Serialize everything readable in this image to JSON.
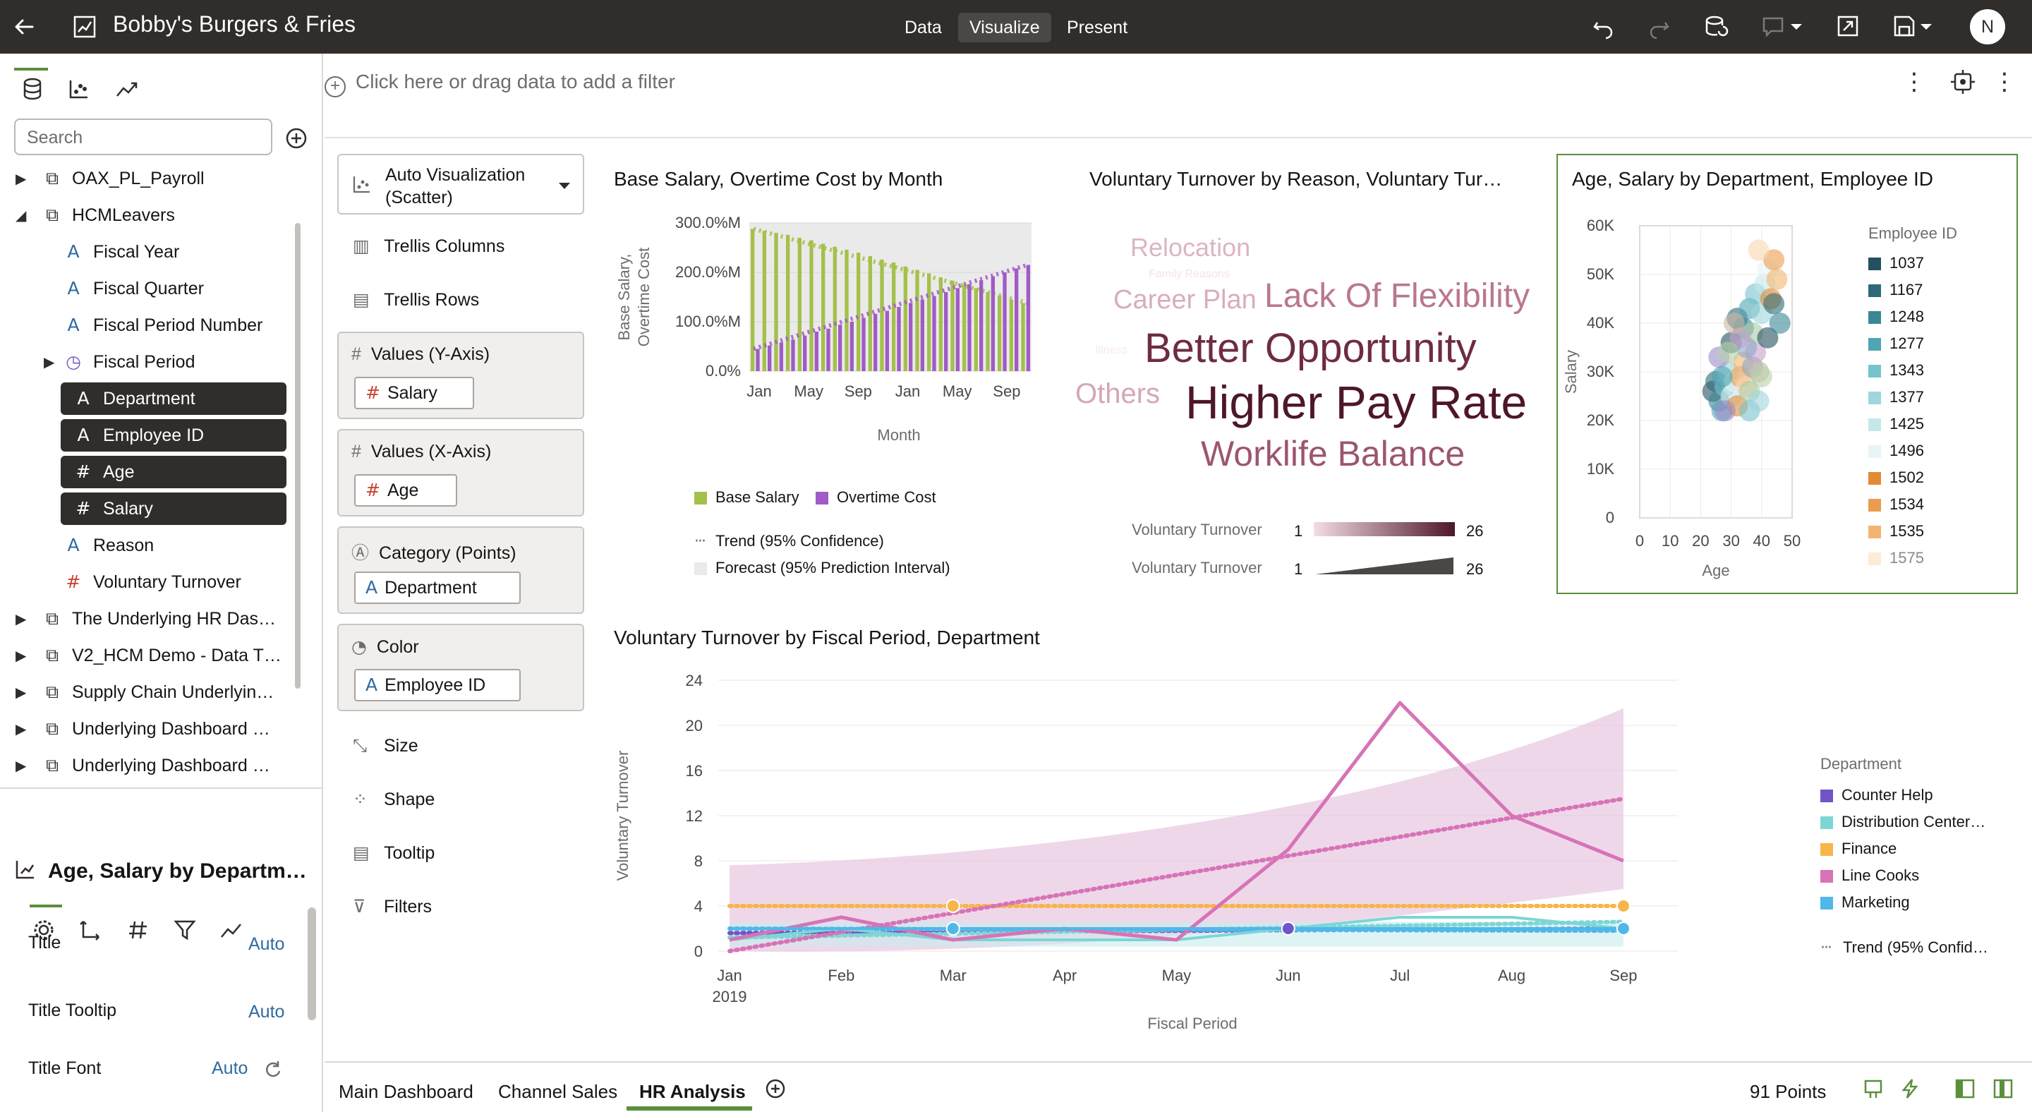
{
  "app": {
    "title": "Bobby's Burgers & Fries"
  },
  "modes": [
    "Data",
    "Visualize",
    "Present"
  ],
  "avatar": "N",
  "search": {
    "placeholder": "Search"
  },
  "tree": [
    {
      "label": "OAX_PL_Payroll",
      "level": 0,
      "icon": "dataset",
      "caret": "right"
    },
    {
      "label": "HCMLeavers",
      "level": 0,
      "icon": "dataset",
      "caret": "down"
    },
    {
      "label": "Fiscal Year",
      "level": 1,
      "icon": "A"
    },
    {
      "label": "Fiscal Quarter",
      "level": 1,
      "icon": "A"
    },
    {
      "label": "Fiscal Period Number",
      "level": 1,
      "icon": "A"
    },
    {
      "label": "Fiscal Period",
      "level": 1,
      "icon": "clock",
      "caret": "right"
    },
    {
      "label": "Department",
      "level": 1,
      "icon": "A",
      "selected": true
    },
    {
      "label": "Employee ID",
      "level": 1,
      "icon": "A",
      "selected": true
    },
    {
      "label": "Age",
      "level": 1,
      "icon": "#",
      "selected": true
    },
    {
      "label": "Salary",
      "level": 1,
      "icon": "#",
      "selected": true
    },
    {
      "label": "Reason",
      "level": 1,
      "icon": "A"
    },
    {
      "label": "Voluntary Turnover",
      "level": 1,
      "icon": "#"
    },
    {
      "label": "The Underlying HR Das…",
      "level": 0,
      "icon": "dataset",
      "caret": "right"
    },
    {
      "label": "V2_HCM Demo - Data T…",
      "level": 0,
      "icon": "dataset",
      "caret": "right"
    },
    {
      "label": "Supply Chain Underlyin…",
      "level": 0,
      "icon": "dataset",
      "caret": "right"
    },
    {
      "label": "Underlying Dashboard …",
      "level": 0,
      "icon": "dataset",
      "caret": "right"
    },
    {
      "label": "Underlying Dashboard …",
      "level": 0,
      "icon": "dataset",
      "caret": "right"
    }
  ],
  "properties": {
    "viz_title": "Age, Salary by Departm…",
    "rows": [
      {
        "label": "Title",
        "value": "Auto"
      },
      {
        "label": "Title Tooltip",
        "value": "Auto"
      },
      {
        "label": "Title Font",
        "value": "Auto"
      }
    ]
  },
  "filter_bar": {
    "prompt": "Click here or drag data to add a filter"
  },
  "grammar": {
    "viz_type": "Auto Visualization (Scatter)",
    "trellis_columns": "Trellis Columns",
    "trellis_rows": "Trellis Rows",
    "values_y": {
      "label": "Values (Y-Axis)",
      "item": "Salary"
    },
    "values_x": {
      "label": "Values (X-Axis)",
      "item": "Age"
    },
    "category": {
      "label": "Category (Points)",
      "item": "Department"
    },
    "color": {
      "label": "Color",
      "item": "Employee ID"
    },
    "size": "Size",
    "shape": "Shape",
    "tooltip": "Tooltip",
    "filters": "Filters"
  },
  "viz1": {
    "title": "Base Salary, Overtime Cost by Month",
    "legend": [
      "Base Salary",
      "Overtime Cost"
    ],
    "trend_label": "Trend (95% Confidence)",
    "forecast_label": "Forecast (95% Prediction Interval)"
  },
  "viz2": {
    "title": "Voluntary Turnover by Reason, Voluntary Tur…",
    "words": [
      {
        "text": "Relocation",
        "color": "#dcb5c0"
      },
      {
        "text": "Family Reasons",
        "color": "#f3e3e8"
      },
      {
        "text": "Career Plan",
        "color": "#d8adb9"
      },
      {
        "text": "Lack Of Flexibility",
        "color": "#b9788b"
      },
      {
        "text": "Illness",
        "color": "#f6e9ee"
      },
      {
        "text": "Better Opportunity",
        "color": "#6e2c41"
      },
      {
        "text": "Others",
        "color": "#d4a7b4"
      },
      {
        "text": "Higher Pay Rate",
        "color": "#4e1729"
      },
      {
        "text": "Worklife Balance",
        "color": "#9c5570"
      }
    ],
    "legend_label": "Voluntary Turnover",
    "legend_min": "1",
    "legend_max": "26"
  },
  "viz3": {
    "title": "Age, Salary by Department, Employee ID",
    "legend_title": "Employee ID",
    "legend": [
      {
        "id": "1037",
        "color": "#24505f"
      },
      {
        "id": "1167",
        "color": "#2c6a78"
      },
      {
        "id": "1248",
        "color": "#3a8796"
      },
      {
        "id": "1277",
        "color": "#4ea5b3"
      },
      {
        "id": "1343",
        "color": "#77c3cc"
      },
      {
        "id": "1377",
        "color": "#9ed6dc"
      },
      {
        "id": "1425",
        "color": "#c6e7ea"
      },
      {
        "id": "1496",
        "color": "#e8f4f5"
      },
      {
        "id": "1502",
        "color": "#e38a34"
      },
      {
        "id": "1534",
        "color": "#eb9d4d"
      },
      {
        "id": "1535",
        "color": "#f2b571"
      },
      {
        "id": "1575",
        "color": "#f8d7b0"
      }
    ]
  },
  "viz4": {
    "title": "Voluntary Turnover by Fiscal Period, Department",
    "legend_title": "Department",
    "legend": [
      {
        "name": "Counter Help",
        "color": "#7154c8"
      },
      {
        "name": "Distribution Center…",
        "color": "#7dd6d6"
      },
      {
        "name": "Finance",
        "color": "#f7b54a"
      },
      {
        "name": "Line Cooks",
        "color": "#d773b6"
      },
      {
        "name": "Marketing",
        "color": "#4fb8e8"
      }
    ],
    "trend_label": "Trend (95% Confid…"
  },
  "chart_data": [
    {
      "type": "bar",
      "title": "Base Salary, Overtime Cost by Month",
      "xlabel": "Month",
      "ylabel": "Base Salary, Overtime Cost",
      "ylim": [
        0,
        300
      ],
      "yticks": [
        "0.0%",
        "100.0%M",
        "200.0%M",
        "300.0%M"
      ],
      "xticks": [
        "Jan",
        "May",
        "Sep",
        "Jan",
        "May",
        "Sep"
      ],
      "series": [
        {
          "name": "Base Salary",
          "color": "#a3c14a",
          "values": [
            288,
            284,
            280,
            276,
            270,
            265,
            258,
            252,
            246,
            240,
            233,
            226,
            220,
            212,
            205,
            198,
            190,
            183,
            175,
            168,
            160,
            153,
            145,
            138
          ]
        },
        {
          "name": "Overtime Cost",
          "color": "#a05bc6",
          "values": [
            45,
            52,
            58,
            64,
            72,
            80,
            86,
            94,
            100,
            108,
            116,
            122,
            130,
            138,
            145,
            152,
            160,
            168,
            176,
            184,
            192,
            200,
            208,
            215
          ]
        }
      ]
    },
    {
      "type": "scatter",
      "title": "Age, Salary by Department, Employee ID",
      "xlabel": "Age",
      "ylabel": "Salary",
      "xlim": [
        0,
        50
      ],
      "ylim": [
        0,
        60000
      ],
      "xticks": [
        "0",
        "10",
        "20",
        "30",
        "40",
        "50"
      ],
      "yticks": [
        "0",
        "10K",
        "20K",
        "30K",
        "40K",
        "50K",
        "60K"
      ],
      "points": [
        [
          24,
          26000
        ],
        [
          25,
          28000
        ],
        [
          26,
          24000
        ],
        [
          27,
          22000
        ],
        [
          28,
          27000
        ],
        [
          29,
          30000
        ],
        [
          30,
          25000
        ],
        [
          31,
          28000
        ],
        [
          32,
          23000
        ],
        [
          33,
          29000
        ],
        [
          34,
          32000
        ],
        [
          35,
          27000
        ],
        [
          36,
          26000
        ],
        [
          37,
          31000
        ],
        [
          38,
          34000
        ],
        [
          39,
          30000
        ],
        [
          40,
          29000
        ],
        [
          26,
          33000
        ],
        [
          30,
          36000
        ],
        [
          32,
          41000
        ],
        [
          34,
          39000
        ],
        [
          36,
          43000
        ],
        [
          38,
          46000
        ],
        [
          40,
          42000
        ],
        [
          41,
          48000
        ],
        [
          42,
          51000
        ],
        [
          43,
          45000
        ],
        [
          44,
          53000
        ],
        [
          45,
          49000
        ],
        [
          39,
          55000
        ],
        [
          37,
          38000
        ],
        [
          35,
          35000
        ],
        [
          33,
          37000
        ],
        [
          31,
          40000
        ],
        [
          29,
          34000
        ],
        [
          28,
          22000
        ],
        [
          42,
          37000
        ],
        [
          44,
          44000
        ],
        [
          46,
          40000
        ],
        [
          27,
          29000
        ],
        [
          36,
          22000
        ],
        [
          39,
          24000
        ]
      ]
    },
    {
      "type": "line",
      "title": "Voluntary Turnover by Fiscal Period, Department",
      "xlabel": "Fiscal Period",
      "ylabel": "Voluntary Turnover",
      "ylim": [
        0,
        24
      ],
      "yticks": [
        "0",
        "4",
        "8",
        "12",
        "16",
        "20",
        "24"
      ],
      "categories": [
        "Jan 2019",
        "Feb",
        "Mar",
        "Apr",
        "May",
        "Jun",
        "Jul",
        "Aug",
        "Sep"
      ],
      "series": [
        {
          "name": "Counter Help",
          "values": [
            2,
            2,
            2,
            2,
            2,
            2,
            2,
            2,
            2
          ]
        },
        {
          "name": "Distribution Center…",
          "values": [
            1,
            2,
            1,
            1,
            1,
            2,
            3,
            3,
            2
          ]
        },
        {
          "name": "Finance",
          "values": [
            4,
            4,
            4,
            4,
            4,
            4,
            4,
            4,
            4
          ]
        },
        {
          "name": "Line Cooks",
          "values": [
            1,
            3,
            1,
            2,
            1,
            9,
            22,
            12,
            8
          ]
        },
        {
          "name": "Marketing",
          "values": [
            2,
            2,
            2,
            2,
            2,
            2,
            2,
            2,
            2
          ]
        }
      ]
    }
  ],
  "bottom_tabs": [
    "Main Dashboard",
    "Channel Sales",
    "HR Analysis"
  ],
  "status": {
    "points": "91 Points"
  }
}
